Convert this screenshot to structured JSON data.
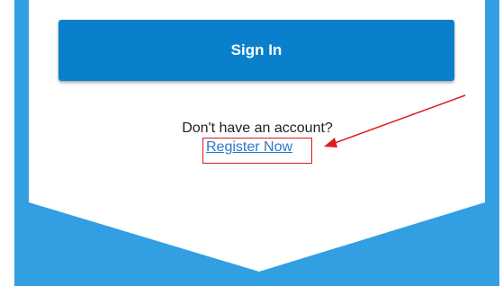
{
  "form": {
    "signin_label": "Sign In",
    "no_account_text": "Don't have an account?",
    "register_label": "Register Now"
  },
  "colors": {
    "background": "#339fe3",
    "card": "#ffffff",
    "button": "#0a80cc",
    "link": "#2a78c9",
    "annotation": "#e01b1b"
  }
}
